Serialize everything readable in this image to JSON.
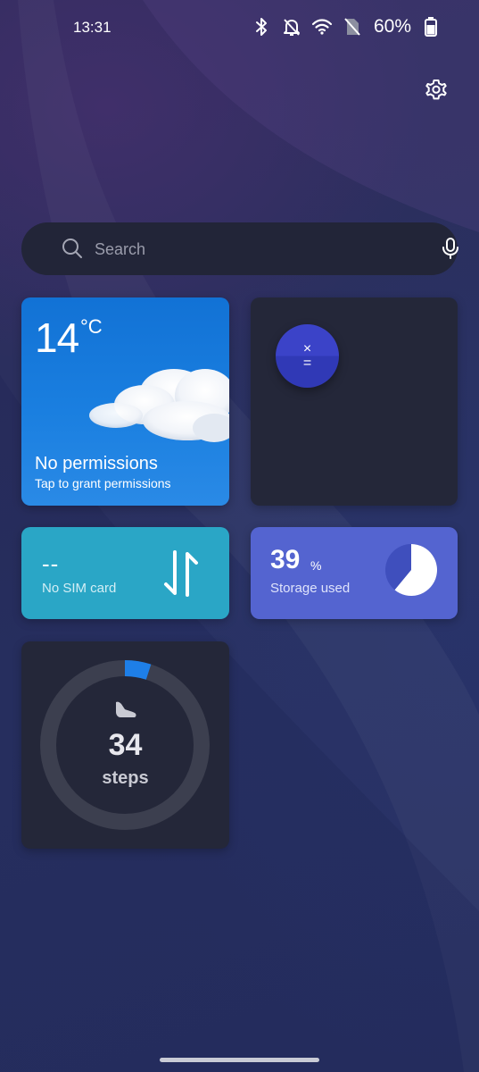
{
  "status_bar": {
    "time": "13:31",
    "battery": "60%",
    "icons": [
      "bluetooth-icon",
      "mute-notifications-icon",
      "wifi-icon",
      "no-sim-icon",
      "battery-icon"
    ]
  },
  "search": {
    "placeholder": "Search",
    "icon": "search-icon",
    "mic_icon": "microphone-icon"
  },
  "settings": {
    "icon": "gear-icon"
  },
  "weather": {
    "temperature": "14",
    "unit": "°C",
    "status": "No permissions",
    "subtitle": "Tap to grant permissions",
    "color": "#1a7fe0"
  },
  "calculator": {
    "symbol_top": "×",
    "symbol_bottom": "=",
    "color": "#3b43c8"
  },
  "sim": {
    "value": "--",
    "label": "No SIM card",
    "color": "#2aa6c6"
  },
  "storage": {
    "value": "39",
    "unit": "%",
    "label": "Storage used",
    "used_fraction": 0.39,
    "color": "#5464d0"
  },
  "steps": {
    "count": "34",
    "label": "steps",
    "progress_fraction": 0.05,
    "accent": "#1e7fe8"
  },
  "colors": {
    "widget_dark": "#242739",
    "search_bg": "#222538"
  }
}
